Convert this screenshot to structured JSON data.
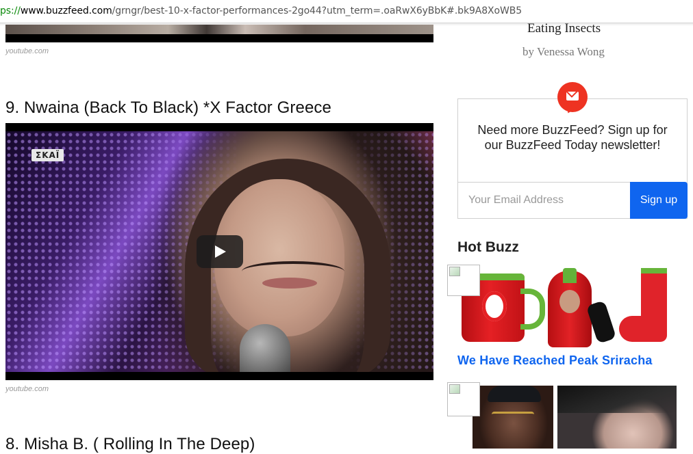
{
  "browser": {
    "url_scheme": "ps://",
    "url_domain": "www.buzzfeed.com",
    "url_path": "/grngr/best-10-x-factor-performances-2go44?utm_term=.oaRwX6yBbK#.bk9A8XoWB5"
  },
  "list": {
    "top_source": "youtube.com",
    "item9": {
      "title": "9. Nwaina (Back To Black) *X Factor Greece",
      "channel_logo": "ΣΚΑΪ",
      "source": "youtube.com"
    },
    "item8": {
      "title": "8. Misha B. ( Rolling In The Deep)"
    }
  },
  "sidebar": {
    "article": {
      "title": "Eating Insects",
      "byline": "by Venessa Wong"
    },
    "newsletter": {
      "icon": "envelope-icon",
      "text": "Need more BuzzFeed? Sign up for our BuzzFeed Today newsletter!",
      "email_placeholder": "Your Email Address",
      "email_value": "",
      "signup_label": "Sign up"
    },
    "hot_buzz": {
      "heading": "Hot Buzz",
      "item1": {
        "title": "We Have Reached Peak Sriracha"
      }
    }
  },
  "colors": {
    "accent_blue": "#0f65ef",
    "badge_red": "#ee3322",
    "url_green": "#0a8a0a"
  }
}
